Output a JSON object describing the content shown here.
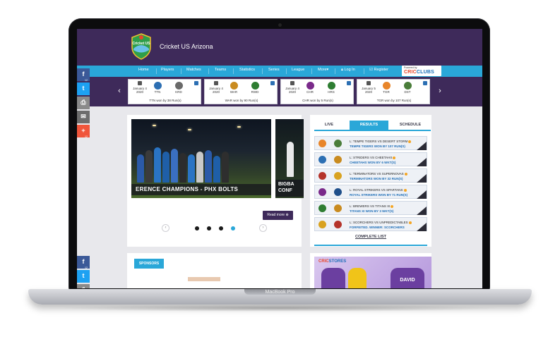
{
  "device": {
    "base_label": "MacBook Pro"
  },
  "site": {
    "title": "Cricket US Arizona",
    "logo_text": "Cricket US"
  },
  "nav": {
    "items": [
      "Home",
      "Players",
      "Matches",
      "Teams",
      "Statistics",
      "Series",
      "League",
      "More▾",
      "Log In",
      "Register"
    ],
    "powered_by": "Powered by",
    "brand_a": "CRIC",
    "brand_b": "CLUBS"
  },
  "ticker": {
    "prev": "‹",
    "next": "›",
    "matches": [
      {
        "date": "January 4",
        "year": "2020",
        "team1": "TTN",
        "team2": "KRD",
        "result": "TTN won by 38 Run(s)",
        "c1": "#2c6fb3",
        "c2": "#6a6a6a"
      },
      {
        "date": "January 4",
        "year": "2020",
        "team1": "WAR",
        "team2": "RWD",
        "result": "WAR won by 90 Run(s)",
        "c1": "#c98b1f",
        "c2": "#2e7d32"
      },
      {
        "date": "January 4",
        "year": "2020",
        "team1": "CHR",
        "team2": "HRS",
        "result": "CHR won by 5 Run(s)",
        "c1": "#7a2a8a",
        "c2": "#2e7d32"
      },
      {
        "date": "January 5",
        "year": "2020",
        "team1": "TGR",
        "team2": "DST",
        "result": "TGR won by 107 Run(s)",
        "c1": "#e8852a",
        "c2": "#4a7d3a"
      }
    ]
  },
  "share": {
    "top": [
      {
        "icon": "f",
        "count": "12",
        "color": "#3b5998"
      },
      {
        "icon": "t",
        "count": "",
        "color": "#1da1f2"
      },
      {
        "icon": "⎙",
        "count": "",
        "color": "#8a8a8a"
      },
      {
        "icon": "✉",
        "count": "",
        "color": "#6d6d6d"
      },
      {
        "icon": "+",
        "count": "12",
        "color": "#f0553b"
      }
    ],
    "bottom": [
      {
        "icon": "f",
        "count": "12",
        "color": "#3b5998"
      },
      {
        "icon": "t",
        "count": "",
        "color": "#1da1f2"
      },
      {
        "icon": "⎙",
        "count": "",
        "color": "#8a8a8a"
      }
    ]
  },
  "slider": {
    "caption": "ERENCE CHAMPIONS - PHX BOLTS",
    "caption2_line1": "BIGBA",
    "caption2_line2": "CONF",
    "read_more": "Read more ⊕",
    "prev": "‹",
    "next": "›",
    "dots": 4,
    "active_dot": 4
  },
  "results": {
    "tabs": [
      "LIVE",
      "RESULTS",
      "SCHEDULE"
    ],
    "active_tab": "RESULTS",
    "rows": [
      {
        "title": "L: TEMPE TIGERS VS DESERT STORM",
        "result": "TEMPE TIGERS WON BY 107 RUN(S)",
        "c1": "#e8852a",
        "c2": "#4a7d3a"
      },
      {
        "title": "L: STRIDERS VS CHEETAHS",
        "result": "CHEETAHS WON BY 6 WKT(S)",
        "c1": "#2c6fb3",
        "c2": "#c98b1f"
      },
      {
        "title": "L: TERMINATORS VS SUPERNOVAS",
        "result": "TERMINATORS WON BY 32 RUN(S)",
        "c1": "#b5332a",
        "c2": "#d9a21f"
      },
      {
        "title": "L: ROYAL STRIKERS VS SPARTANS",
        "result": "ROYAL STRIKERS WON BY 71 RUN(S)",
        "c1": "#7a2a8a",
        "c2": "#1f4f8a"
      },
      {
        "title": "L: BREWERS VS TITANS XI",
        "result": "TITANS XI WON BY 3 WKT(S)",
        "c1": "#2e7d32",
        "c2": "#c98b1f"
      },
      {
        "title": "L: SCORCHERS VS UNPREDICTABLES",
        "result": "FORFEITED. WINNER: SCORCHERS",
        "c1": "#d9a21f",
        "c2": "#b5332a"
      }
    ],
    "complete_list": "COMPLETE LIST"
  },
  "sponsors": {
    "label": "SPONSORS"
  },
  "store": {
    "brand_a": "CRIC",
    "brand_b": "STORES",
    "jersey_text": "DAVID"
  }
}
